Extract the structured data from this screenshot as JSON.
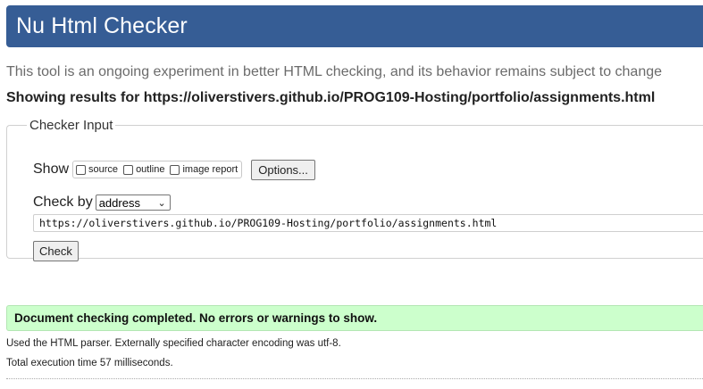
{
  "header": {
    "title": "Nu Html Checker"
  },
  "tagline": "This tool is an ongoing experiment in better HTML checking, and its behavior remains subject to change",
  "showing": "Showing results for https://oliverstivers.github.io/PROG109-Hosting/portfolio/assignments.html",
  "checker": {
    "legend": "Checker Input",
    "show_label": "Show",
    "options": [
      {
        "label": "source",
        "checked": false
      },
      {
        "label": "outline",
        "checked": false
      },
      {
        "label": "image report",
        "checked": false
      }
    ],
    "options_button": "Options...",
    "check_by_label": "Check by",
    "check_by_value": "address",
    "url_value": "https://oliverstivers.github.io/PROG109-Hosting/portfolio/assignments.html",
    "check_button": "Check"
  },
  "result": {
    "message": "Document checking completed. No errors or warnings to show.",
    "parser_info": "Used the HTML parser. Externally specified character encoding was utf-8.",
    "execution_time": "Total execution time 57 milliseconds."
  },
  "colors": {
    "header_bg": "#365d95",
    "success_bg": "#ccffcc"
  }
}
